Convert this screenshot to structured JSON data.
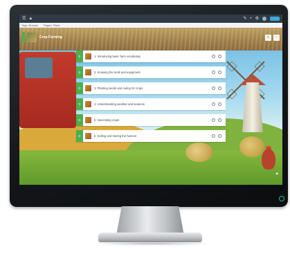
{
  "app": {
    "topbar": {
      "menu_icon": "menu-icon",
      "home_icon": "home-icon",
      "right_icons": [
        "edit-icon",
        "bell-icon",
        "settings-icon",
        "user-icon"
      ],
      "brand_label": ""
    },
    "subbar": {
      "items": [
        "Tags: Browse",
        "Pages: Flash"
      ]
    }
  },
  "course": {
    "title": "Crop Farming",
    "header_actions": [
      "+",
      "⋯"
    ]
  },
  "lessons": [
    {
      "label": "1. Introducing basic farm vocabulary",
      "thumb_icon": "lesson-thumb-icon"
    },
    {
      "label": "2. Knowing the tools and equipment",
      "thumb_icon": "lesson-thumb-icon"
    },
    {
      "label": "3. Planting seeds and caring for crops",
      "thumb_icon": "lesson-thumb-icon"
    },
    {
      "label": "4. Understanding weather and seasons",
      "thumb_icon": "lesson-thumb-icon"
    },
    {
      "label": "5. Harvesting crops",
      "thumb_icon": "lesson-thumb-icon"
    },
    {
      "label": "6. Selling and storing the harvest",
      "thumb_icon": "lesson-thumb-icon"
    }
  ],
  "colors": {
    "accent": "#4caf50",
    "topbar": "#2f3b46",
    "power_led": "#2fb6a0"
  }
}
